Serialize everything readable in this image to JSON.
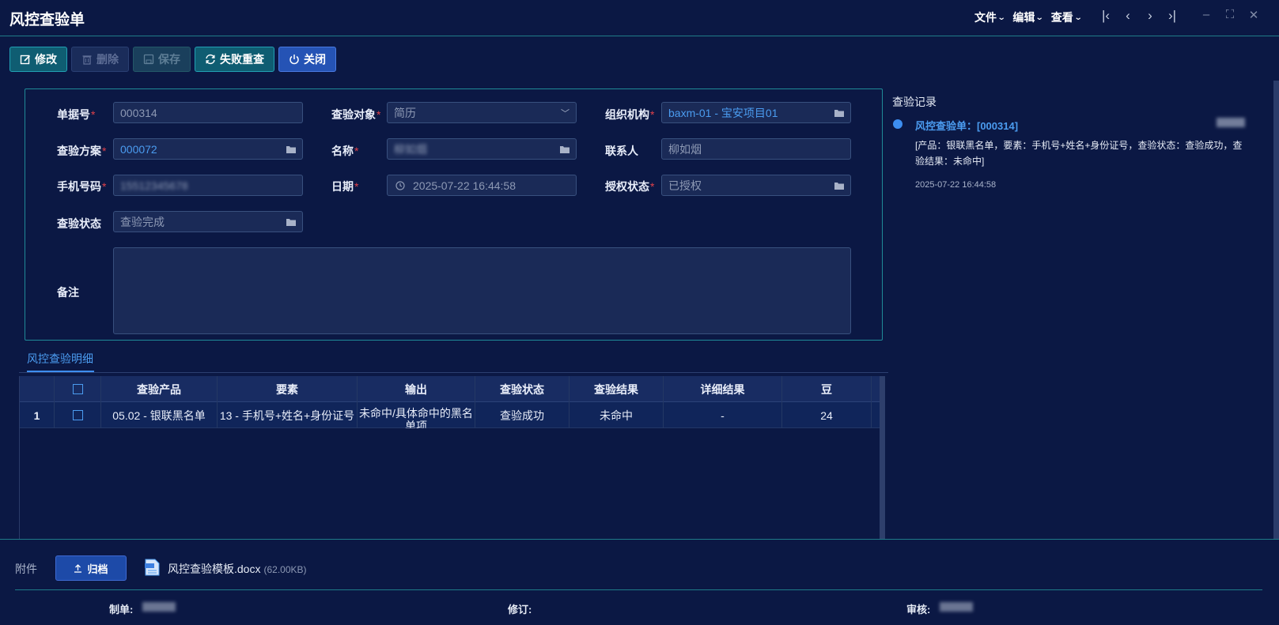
{
  "window": {
    "title": "风控查验单",
    "menus": [
      "文件",
      "编辑",
      "查看"
    ]
  },
  "toolbar": {
    "edit_label": "修改",
    "delete_label": "删除",
    "save_label": "保存",
    "retry_label": "失败重查",
    "close_label": "关闭"
  },
  "form": {
    "doc_no_label": "单据号",
    "doc_no_value": "000314",
    "target_label": "查验对象",
    "target_value": "简历",
    "org_label": "组织机构",
    "org_value": "baxm-01 - 宝安项目01",
    "scheme_label": "查验方案",
    "scheme_value": "000072",
    "name_label": "名称",
    "name_value": "柳如烟",
    "contact_label": "联系人",
    "contact_value": "柳如烟",
    "phone_label": "手机号码",
    "phone_value": "15512345678",
    "date_label": "日期",
    "date_value": "2025-07-22 16:44:58",
    "auth_label": "授权状态",
    "auth_value": "已授权",
    "status_label": "查验状态",
    "status_value": "查验完成",
    "remark_label": "备注"
  },
  "records": {
    "title": "查验记录",
    "entry_title": "风控查验单：[000314]",
    "entry_body": "[产品：银联黑名单，要素：手机号+姓名+身份证号，查验状态：查验成功，查验结果：未命中]",
    "entry_time": "2025-07-22 16:44:58"
  },
  "detail": {
    "tab_label": "风控查验明细",
    "columns": [
      "查验产品",
      "要素",
      "输出",
      "查验状态",
      "查验结果",
      "详细结果",
      "豆"
    ],
    "rows": [
      {
        "index": "1",
        "product": "05.02 - 银联黑名单",
        "elements": "13 - 手机号+姓名+身份证号",
        "output": "未命中/具体命中的黑名单项",
        "status": "查验成功",
        "result": "未命中",
        "detail": "-",
        "beans": "24"
      }
    ]
  },
  "attachments": {
    "label": "附件",
    "archive_label": "归档",
    "file_name": "风控查验模板.docx",
    "file_size": "(62.00KB)"
  },
  "signatures": {
    "maker_label": "制单:",
    "revise_label": "修订:",
    "review_label": "审核:"
  },
  "colors": {
    "background": "#0b1844",
    "accent": "#4b9cf0",
    "teal": "#1f8a98",
    "required": "#e0414a"
  }
}
